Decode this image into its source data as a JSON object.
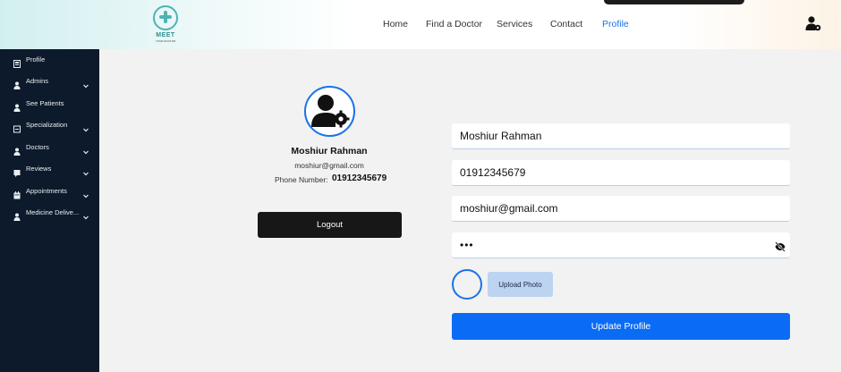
{
  "brand": {
    "name": "MEET",
    "tagline": "YOUR DOCTOR"
  },
  "nav": {
    "items": [
      {
        "label": "Home"
      },
      {
        "label": "Find a Doctor"
      },
      {
        "label": "Services"
      },
      {
        "label": "Contact"
      },
      {
        "label": "Profile",
        "active": true
      }
    ]
  },
  "sidebar": {
    "items": [
      {
        "label": "Profile",
        "icon": "profile-icon",
        "expandable": false
      },
      {
        "label": "Admins",
        "icon": "user-icon",
        "expandable": true
      },
      {
        "label": "See Patients",
        "icon": "user-icon",
        "expandable": false
      },
      {
        "label": "Specialization",
        "icon": "list-icon",
        "expandable": true
      },
      {
        "label": "Doctors",
        "icon": "user-icon",
        "expandable": true
      },
      {
        "label": "Reviews",
        "icon": "review-icon",
        "expandable": true
      },
      {
        "label": "Appointments",
        "icon": "calendar-icon",
        "expandable": true
      },
      {
        "label": "Medicine Delive...",
        "icon": "user-icon",
        "expandable": true
      }
    ]
  },
  "profile": {
    "name": "Moshiur Rahman",
    "email": "moshiur@gmail.com",
    "phone_label": "Phone Number:",
    "phone": "01912345679",
    "logout_label": "Logout"
  },
  "form": {
    "name_value": "Moshiur Rahman",
    "phone_value": "01912345679",
    "email_value": "moshiur@gmail.com",
    "password_value": "•••",
    "upload_label": "Upload Photo",
    "update_label": "Update Profile"
  },
  "colors": {
    "accent": "#0a6cf5",
    "sidebar_bg": "#0d1a2b",
    "logo_teal": "#4fb3b3",
    "upload_bg": "#bcd3f1"
  }
}
